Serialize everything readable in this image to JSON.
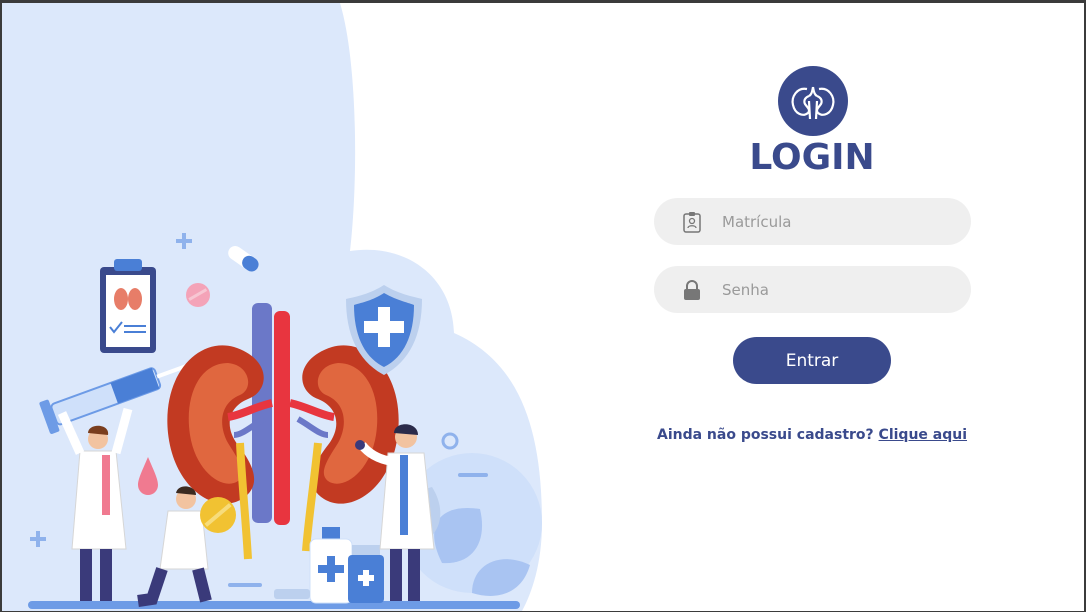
{
  "login": {
    "title": "LOGIN",
    "logo_icon": "kidneys-icon",
    "brand_color": "#3a4a8c"
  },
  "fields": {
    "matricula": {
      "placeholder": "Matrícula",
      "value": "",
      "icon": "id-badge-icon"
    },
    "senha": {
      "placeholder": "Senha",
      "value": "",
      "icon": "lock-icon"
    }
  },
  "submit": {
    "label": "Entrar"
  },
  "signup": {
    "prompt": "Ainda não possui cadastro?",
    "link": "Clique aqui"
  }
}
